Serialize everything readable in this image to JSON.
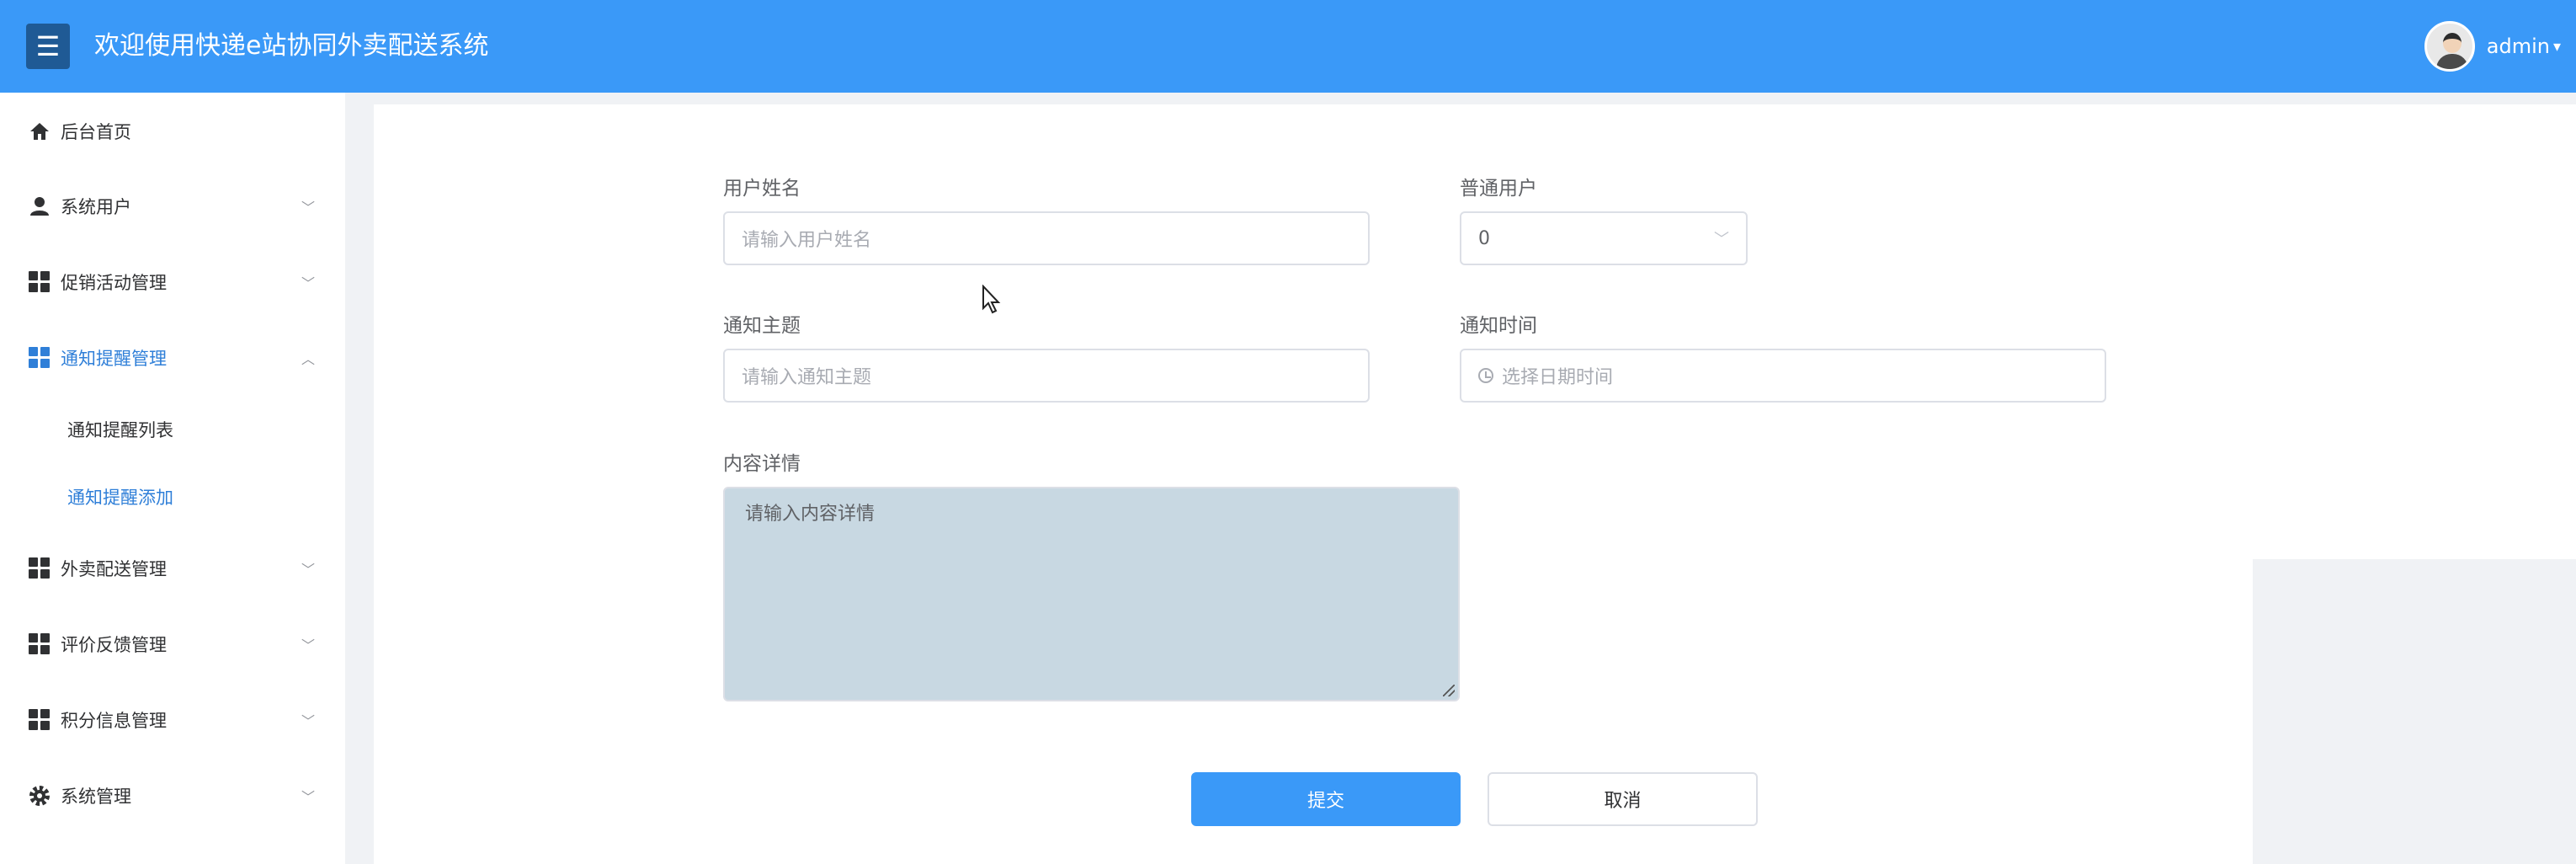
{
  "header": {
    "menu_icon": "hamburger-icon",
    "title": "欢迎使用快递e站协同外卖配送系统",
    "username": "admin",
    "caret": "▾"
  },
  "sidebar": {
    "items": [
      {
        "label": "后台首页",
        "icon": "home-icon"
      },
      {
        "label": "系统用户",
        "icon": "user-icon",
        "chevron": "﹀"
      },
      {
        "label": "促销活动管理",
        "icon": "grid-icon",
        "chevron": "﹀"
      },
      {
        "label": "通知提醒管理",
        "icon": "grid-icon",
        "chevron": "︿",
        "active": true
      },
      {
        "label": "外卖配送管理",
        "icon": "grid-icon",
        "chevron": "﹀"
      },
      {
        "label": "评价反馈管理",
        "icon": "grid-icon",
        "chevron": "﹀"
      },
      {
        "label": "积分信息管理",
        "icon": "grid-icon",
        "chevron": "﹀"
      },
      {
        "label": "系统管理",
        "icon": "gear-icon",
        "chevron": "﹀"
      }
    ],
    "subitems": [
      {
        "label": "通知提醒列表"
      },
      {
        "label": "通知提醒添加",
        "active": true
      }
    ]
  },
  "form": {
    "username_label": "用户姓名",
    "username_placeholder": "请输入用户姓名",
    "usertype_label": "普通用户",
    "usertype_value": "0",
    "subject_label": "通知主题",
    "subject_placeholder": "请输入通知主题",
    "time_label": "通知时间",
    "time_placeholder": "选择日期时间",
    "content_label": "内容详情",
    "content_placeholder": "请输入内容详情",
    "submit_label": "提交",
    "cancel_label": "取消"
  },
  "colors": {
    "header_bg": "#3a99f8",
    "accent": "#2f7fd8",
    "toggle_bg": "#1f5a95",
    "textarea_bg": "#c8d8e2"
  }
}
